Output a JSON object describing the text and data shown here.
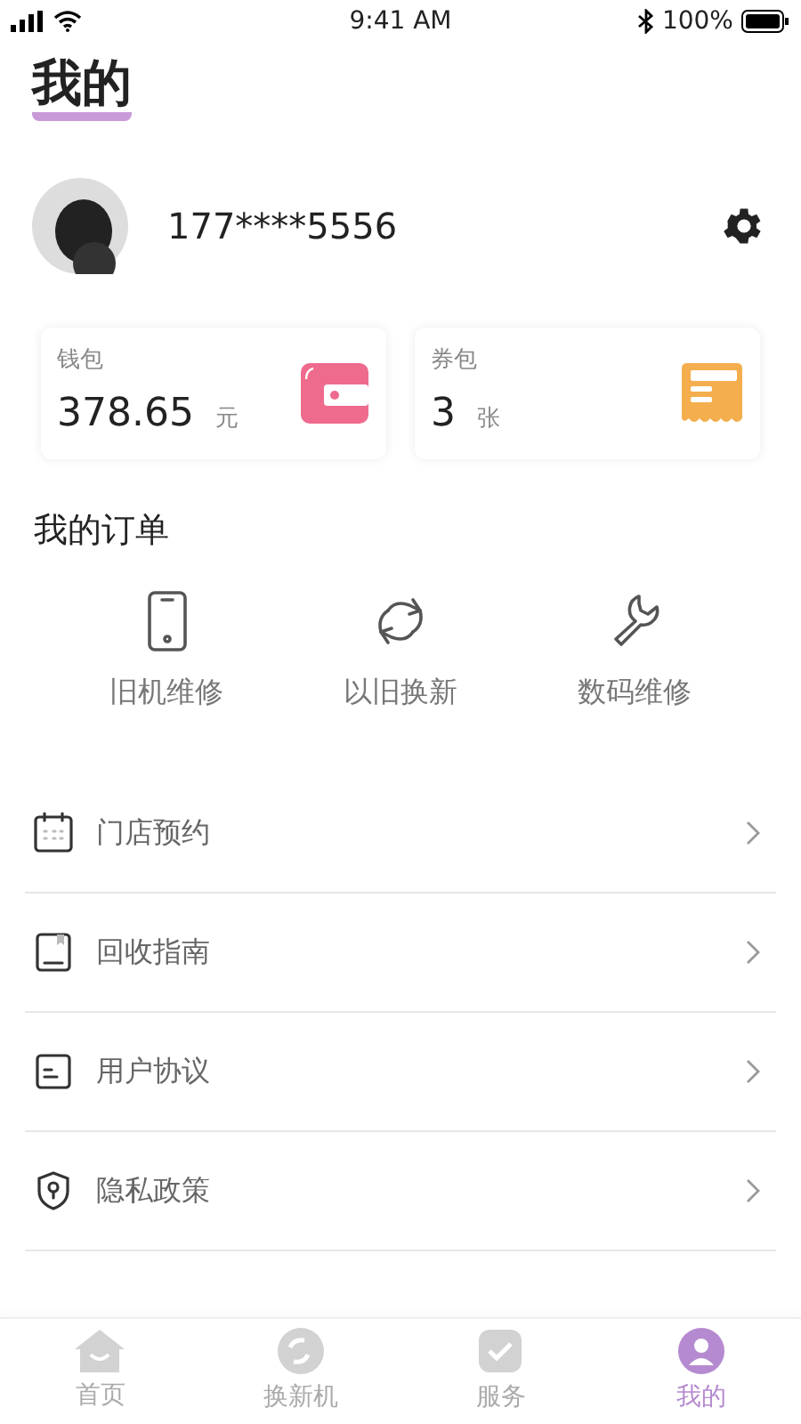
{
  "status_bar": {
    "time": "9:41 AM",
    "battery": "100%"
  },
  "header": {
    "title": "我的"
  },
  "profile": {
    "phone": "177****5556"
  },
  "cards": [
    {
      "kind": "wallet",
      "label": "钱包",
      "value": "378.65",
      "unit": "元"
    },
    {
      "kind": "coupon",
      "label": "券包",
      "value": "3",
      "unit": "张"
    }
  ],
  "orders": {
    "title": "我的订单",
    "items": [
      {
        "kind": "phone",
        "label": "旧机维修"
      },
      {
        "kind": "swap",
        "label": "以旧换新"
      },
      {
        "kind": "wrench",
        "label": "数码维修"
      }
    ]
  },
  "menu": [
    {
      "kind": "calendar",
      "label": "门店预约"
    },
    {
      "kind": "book",
      "label": "回收指南"
    },
    {
      "kind": "doc",
      "label": "用户协议"
    },
    {
      "kind": "shield",
      "label": "隐私政策"
    }
  ],
  "tabs": [
    {
      "kind": "home",
      "label": "首页",
      "selected": false
    },
    {
      "kind": "swap",
      "label": "换新机",
      "selected": false
    },
    {
      "kind": "service",
      "label": "服务",
      "selected": false
    },
    {
      "kind": "me",
      "label": "我的",
      "selected": true
    }
  ]
}
